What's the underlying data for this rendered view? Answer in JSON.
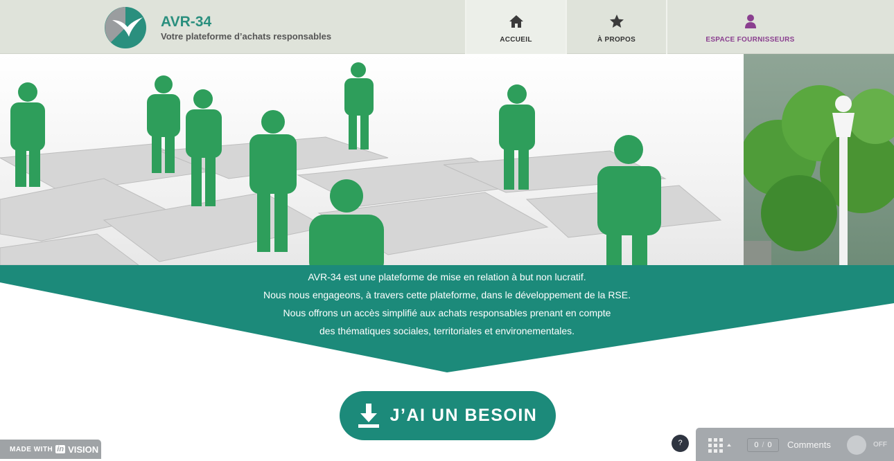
{
  "header": {
    "brand_title": "AVR-34",
    "brand_subtitle": "Votre plateforme d’achats responsables",
    "nav": [
      {
        "label": "ACCUEIL",
        "icon": "home-icon",
        "active": true
      },
      {
        "label": "À PROPOS",
        "icon": "star-icon",
        "active": false
      },
      {
        "label": "ESPACE FOURNISSEURS",
        "icon": "user-icon",
        "active": false
      }
    ]
  },
  "banner": {
    "lines": [
      "AVR-34 est une plateforme de mise en relation à but non lucratif.",
      "Nous nous engageons, à travers cette plateforme, dans le développement de la RSE.",
      "Nous offrons un accès simplifié aux achats responsables prenant en compte",
      "des thématiques sociales, territoriales et environementales."
    ]
  },
  "cta": {
    "label": "J’AI UN BESOIN",
    "icon": "download-icon"
  },
  "footer": {
    "made_with_label": "MADE WITH",
    "made_with_in": "in",
    "made_with_brand": "VISION",
    "help_label": "?",
    "counter_left": "0",
    "counter_right": "0",
    "comments_label": "Comments",
    "toggle_label": "OFF"
  },
  "colors": {
    "teal": "#1c8a7a",
    "accent_purple": "#8a3f8f",
    "header_bg": "#dfe3da"
  }
}
